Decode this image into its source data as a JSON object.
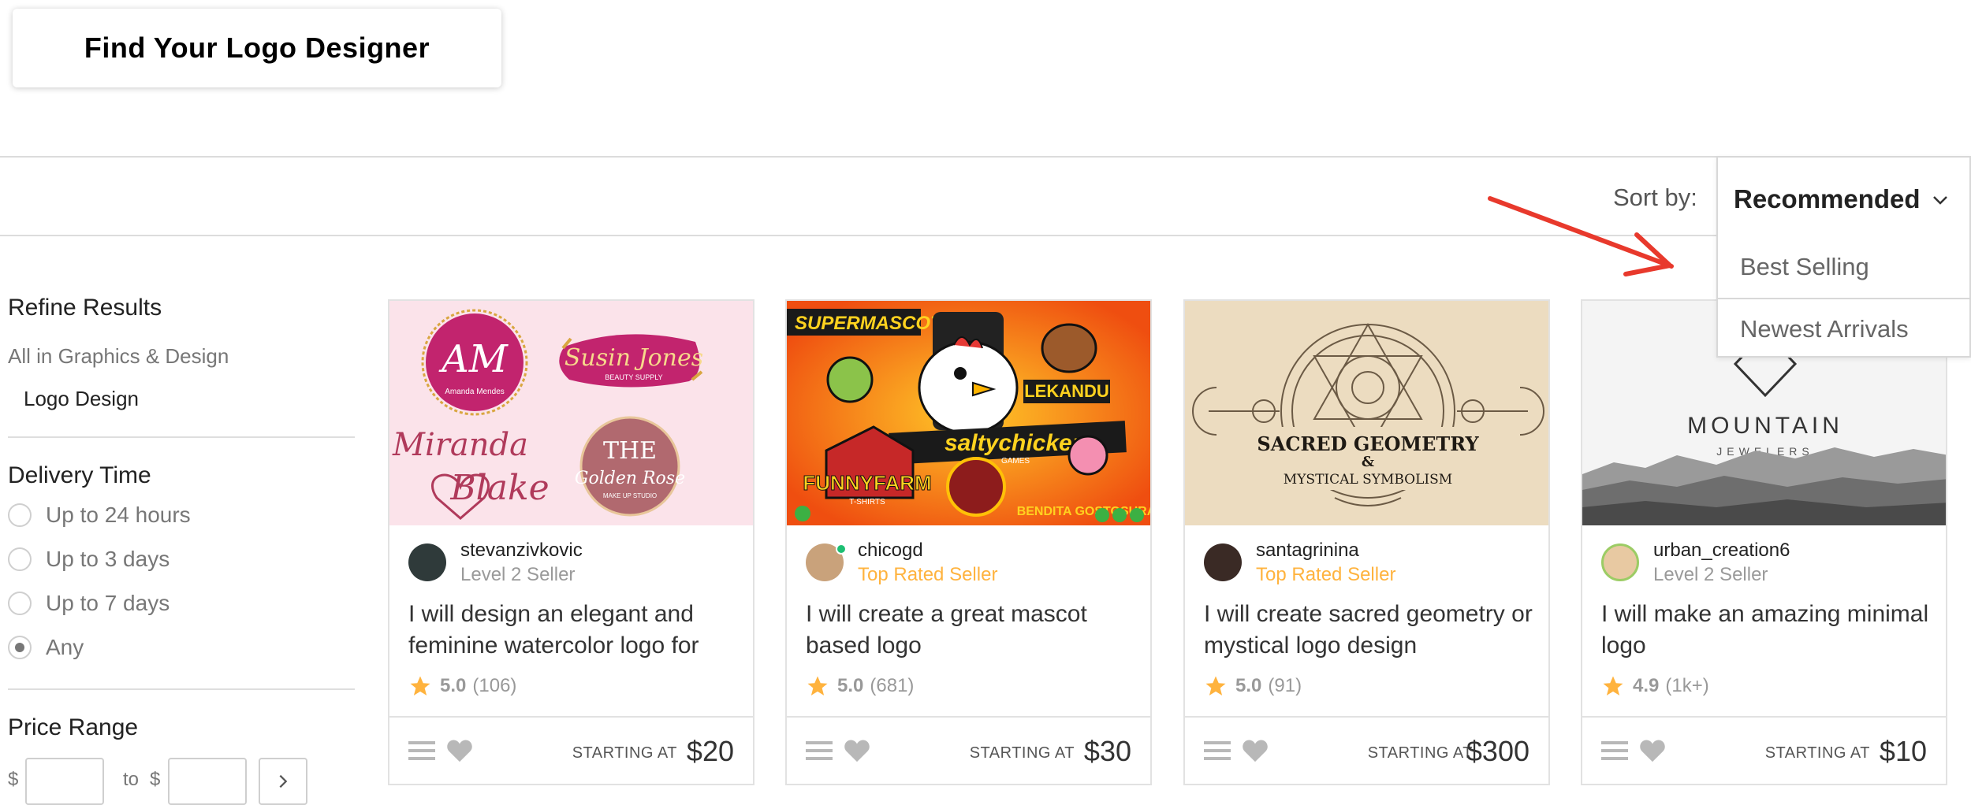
{
  "header": {
    "title": "Find Your Logo Designer"
  },
  "sort": {
    "label": "Sort by:",
    "selected": "Recommended",
    "options": [
      "Best Selling",
      "Newest Arrivals"
    ]
  },
  "sidebar": {
    "heading": "Refine Results",
    "category": "All in Graphics & Design",
    "subcategory": "Logo Design",
    "delivery": {
      "heading": "Delivery Time",
      "options": [
        "Up to 24 hours",
        "Up to 3 days",
        "Up to 7 days",
        "Any"
      ],
      "selected": "Any"
    },
    "price": {
      "heading": "Price Range",
      "currency": "$",
      "to_label": "to"
    }
  },
  "gigs": [
    {
      "seller": "stevanzivkovic",
      "level": "Level 2 Seller",
      "title": "I will design an elegant and feminine watercolor logo for",
      "score": "5.0",
      "count": "(106)",
      "starting_label": "STARTING AT",
      "price": "$20",
      "image_text": [
        "AM",
        "Amanda Mendes",
        "Susin Jones",
        "BEAUTY SUPPLY",
        "Miranda",
        "Blake",
        "THE",
        "Golden Rose",
        "MAKE UP STUDIO"
      ]
    },
    {
      "seller": "chicogd",
      "level": "Top Rated Seller",
      "title": "I will create a great mascot based logo",
      "score": "5.0",
      "count": "(681)",
      "starting_label": "STARTING AT",
      "price": "$30",
      "image_text": [
        "SUPERMASCOTS",
        "saltychicken",
        "GAMES",
        "LEKANDU",
        "FUNNYFARM",
        "T-SHIRTS",
        "BENDITA GOSTOSURA"
      ]
    },
    {
      "seller": "santagrinina",
      "level": "Top Rated Seller",
      "title": "I will create sacred geometry or mystical logo design",
      "score": "5.0",
      "count": "(91)",
      "starting_label": "STARTING AT",
      "price": "$300",
      "image_text": [
        "SACRED GEOMETRY",
        "&",
        "MYSTICAL SYMBOLISM"
      ]
    },
    {
      "seller": "urban_creation6",
      "level": "Level 2 Seller",
      "title": "I will make an amazing minimal logo",
      "score": "4.9",
      "count": "(1k+)",
      "starting_label": "STARTING AT",
      "price": "$10",
      "image_text": [
        "MOUNTAIN",
        "JEWELERS"
      ]
    }
  ],
  "colors": {
    "accent": "#ffb33e",
    "online": "#1dbf73",
    "arrow": "#e8392c"
  }
}
